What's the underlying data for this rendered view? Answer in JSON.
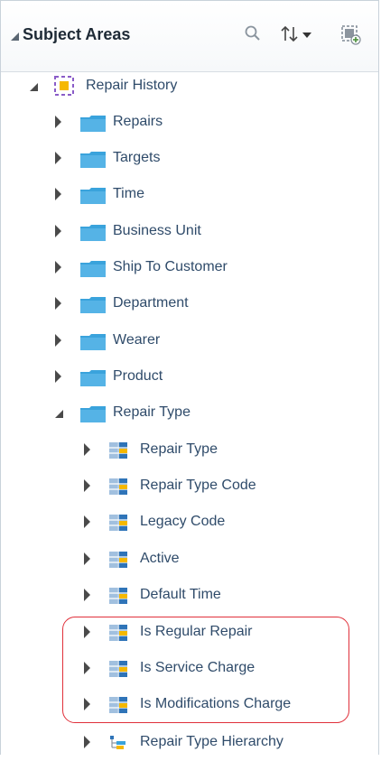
{
  "panel": {
    "title": "Subject Areas",
    "header_icons": [
      "search-icon",
      "sort-icon",
      "add-subject-area-icon"
    ]
  },
  "tree": {
    "root": {
      "label": "Repair History",
      "icon": "subject-area-icon",
      "expanded": true
    },
    "folders": [
      {
        "label": "Repairs",
        "expanded": false
      },
      {
        "label": "Targets",
        "expanded": false
      },
      {
        "label": "Time",
        "expanded": false
      },
      {
        "label": "Business Unit",
        "expanded": false
      },
      {
        "label": "Ship To Customer",
        "expanded": false
      },
      {
        "label": "Department",
        "expanded": false
      },
      {
        "label": "Wearer",
        "expanded": false
      },
      {
        "label": "Product",
        "expanded": false
      },
      {
        "label": "Repair Type",
        "expanded": true
      }
    ],
    "repair_type_children": [
      {
        "label": "Repair Type",
        "icon": "column-icon"
      },
      {
        "label": "Repair Type Code",
        "icon": "column-icon"
      },
      {
        "label": "Legacy Code",
        "icon": "column-icon"
      },
      {
        "label": "Active",
        "icon": "column-icon"
      },
      {
        "label": "Default Time",
        "icon": "column-icon"
      },
      {
        "label": "Is Regular Repair",
        "icon": "column-icon"
      },
      {
        "label": "Is Service Charge",
        "icon": "column-icon"
      },
      {
        "label": "Is Modifications Charge",
        "icon": "column-icon"
      },
      {
        "label": "Repair Type Hierarchy",
        "icon": "hierarchy-icon"
      }
    ]
  },
  "colors": {
    "folder": "#3aa3dc",
    "highlight_border": "#e0303a",
    "root_icon_purple": "#8a5cc8",
    "root_icon_yellow": "#f5b800"
  }
}
